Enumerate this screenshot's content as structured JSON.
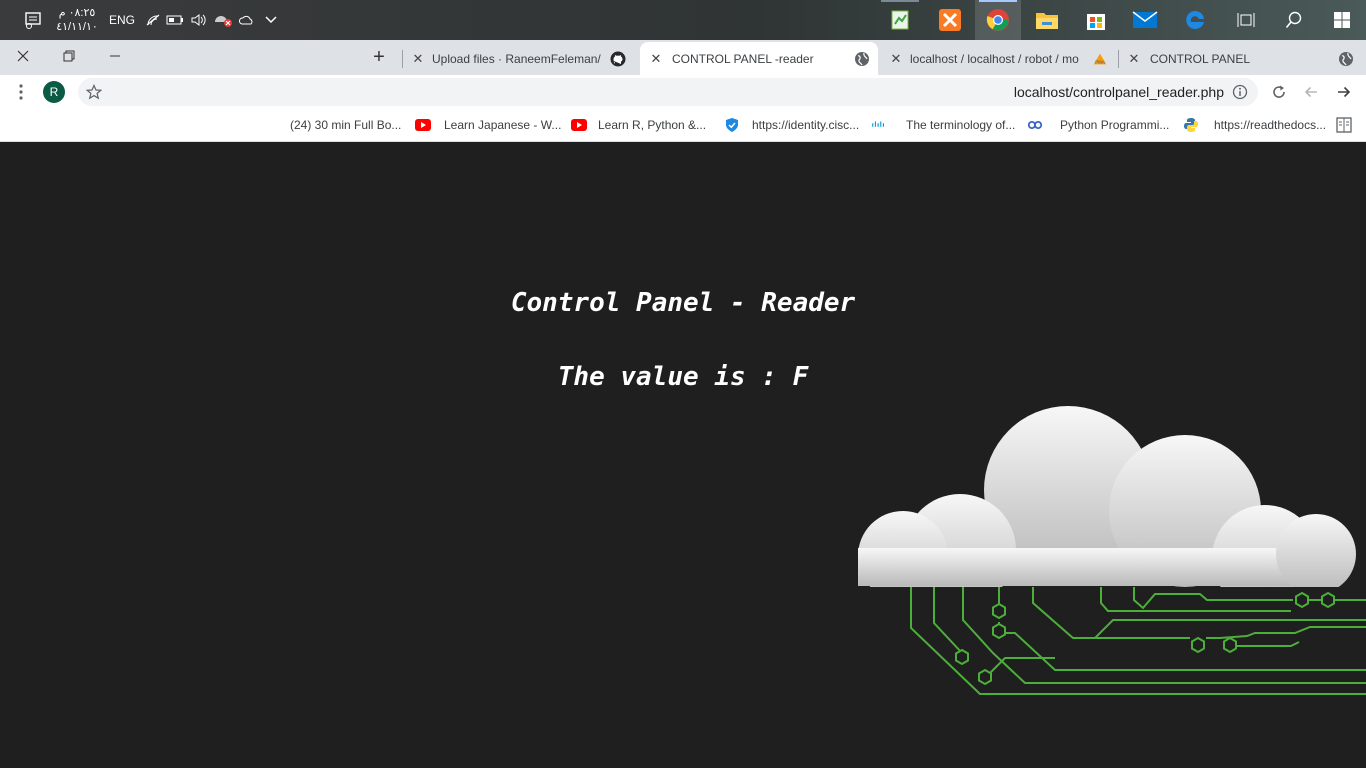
{
  "taskbar": {
    "clock_time": "٠٨:٢٥ م",
    "clock_date": "٤١/١١/١٠",
    "language": "ENG",
    "apps": [
      {
        "name": "notepad-app-icon"
      },
      {
        "name": "xampp-app-icon"
      },
      {
        "name": "chrome-app-icon"
      },
      {
        "name": "file-explorer-app-icon"
      },
      {
        "name": "store-app-icon"
      },
      {
        "name": "mail-app-icon"
      },
      {
        "name": "edge-app-icon"
      },
      {
        "name": "task-view-icon"
      },
      {
        "name": "search-icon"
      },
      {
        "name": "windows-start-icon"
      }
    ]
  },
  "tabs": [
    {
      "title": "Upload files · RaneemFeleman/",
      "favicon": "github-icon"
    },
    {
      "title": "CONTROL PANEL -reader",
      "favicon": "globe-icon",
      "active": true
    },
    {
      "title": "localhost / localhost / robot / mo",
      "favicon": "phpmyadmin-icon"
    },
    {
      "title": "CONTROL PANEL",
      "favicon": "globe-icon"
    }
  ],
  "toolbar": {
    "url": "localhost/controlpanel_reader.php",
    "avatar_letter": "R"
  },
  "bookmarks": [
    {
      "label": "(24) 30 min Full Bo...",
      "icon": "youtube-icon"
    },
    {
      "label": "Learn Japanese - W...",
      "icon": "youtube-icon"
    },
    {
      "label": "Learn R, Python &...",
      "icon": "shield-icon"
    },
    {
      "label": "https://identity.cisc...",
      "icon": "cisco-icon"
    },
    {
      "label": "The terminology of...",
      "icon": "link-icon"
    },
    {
      "label": "Python Programmi...",
      "icon": "python-icon"
    },
    {
      "label": "https://readthedocs..."
    }
  ],
  "page": {
    "title": "Control Panel - Reader",
    "value_text": "The value is : F"
  },
  "colors": {
    "page_bg": "#1f1f1f",
    "circuit_green": "#4caf3a",
    "youtube_red": "#ff0000"
  }
}
